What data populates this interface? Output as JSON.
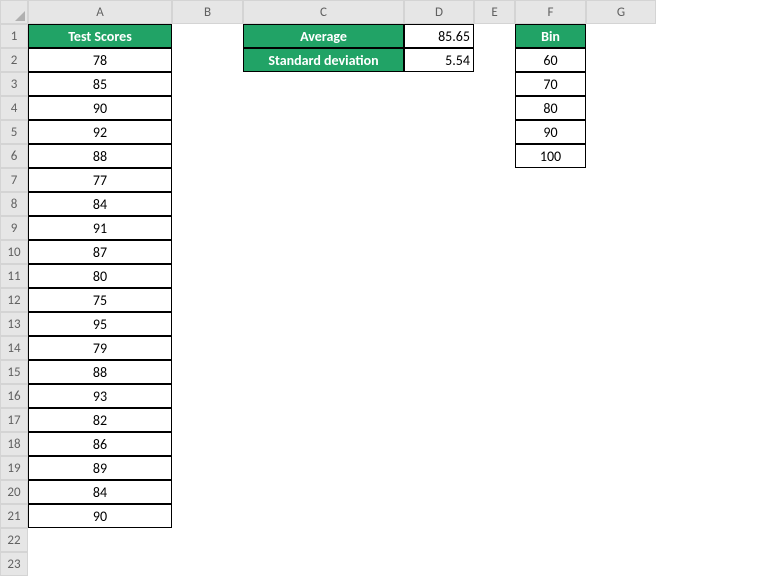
{
  "columns": [
    "A",
    "B",
    "C",
    "D",
    "E",
    "F",
    "G"
  ],
  "rows": [
    "1",
    "2",
    "3",
    "4",
    "5",
    "6",
    "7",
    "8",
    "9",
    "10",
    "11",
    "12",
    "13",
    "14",
    "15",
    "16",
    "17",
    "18",
    "19",
    "20",
    "21",
    "22",
    "23"
  ],
  "headers": {
    "test_scores": "Test Scores",
    "average": "Average",
    "std_dev": "Standard deviation",
    "bin": "Bin"
  },
  "stats": {
    "average": "85.65",
    "std_dev": "5.54"
  },
  "test_scores": [
    "78",
    "85",
    "90",
    "92",
    "88",
    "77",
    "84",
    "91",
    "87",
    "80",
    "75",
    "95",
    "79",
    "88",
    "93",
    "82",
    "86",
    "89",
    "84",
    "90"
  ],
  "bins": [
    "60",
    "70",
    "80",
    "90",
    "100"
  ]
}
